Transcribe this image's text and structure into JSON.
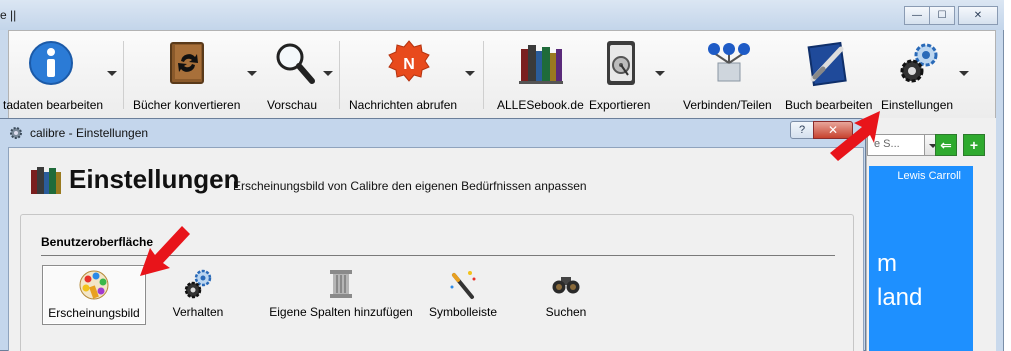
{
  "main_window": {
    "title": "e ||",
    "controls": {
      "minimize": "—",
      "maximize": "☐",
      "close": "✕"
    }
  },
  "toolbar": {
    "items": [
      {
        "label": "tadaten bearbeiten",
        "icon": "info-icon",
        "has_dropdown": true
      },
      {
        "label": "Bücher konvertieren",
        "icon": "convert-book-icon",
        "has_dropdown": true
      },
      {
        "label": "Vorschau",
        "icon": "magnifier-icon",
        "has_dropdown": true
      },
      {
        "label": "Nachrichten abrufen",
        "icon": "news-icon",
        "has_dropdown": true
      },
      {
        "label": "ALLESebook.de",
        "icon": "bookshelf-icon",
        "has_dropdown": false
      },
      {
        "label": "Exportieren",
        "icon": "export-disk-icon",
        "has_dropdown": true
      },
      {
        "label": "Verbinden/Teilen",
        "icon": "connect-share-icon",
        "has_dropdown": false
      },
      {
        "label": "Buch bearbeiten",
        "icon": "edit-book-icon",
        "has_dropdown": false
      },
      {
        "label": "Einstellungen",
        "icon": "settings-gears-icon",
        "has_dropdown": true
      }
    ]
  },
  "right_panel": {
    "search_placeholder": "e S...",
    "cover": {
      "author": "Lewis Carroll",
      "line1": "m",
      "line2": "land"
    }
  },
  "dialog": {
    "title": "calibre - Einstellungen",
    "help_button": "?",
    "close_button": "✕",
    "heading": "Einstellungen",
    "subheading": "Erscheinungsbild von Calibre den eigenen Bedürfnissen anpassen",
    "group": {
      "title": "Benutzeroberfläche",
      "items": [
        {
          "label": "Erscheinungsbild",
          "icon": "palette-icon",
          "selected": true
        },
        {
          "label": "Verhalten",
          "icon": "gears-icon",
          "selected": false
        },
        {
          "label": "Eigene Spalten hinzufügen",
          "icon": "column-icon",
          "selected": false
        },
        {
          "label": "Symbolleiste",
          "icon": "magic-wand-icon",
          "selected": false
        },
        {
          "label": "Suchen",
          "icon": "binoculars-icon",
          "selected": false
        }
      ]
    }
  },
  "colors": {
    "accent_arrow": "#e8141a",
    "cover_blue": "#1e90ff",
    "window_frame": "#c4d6ec"
  }
}
